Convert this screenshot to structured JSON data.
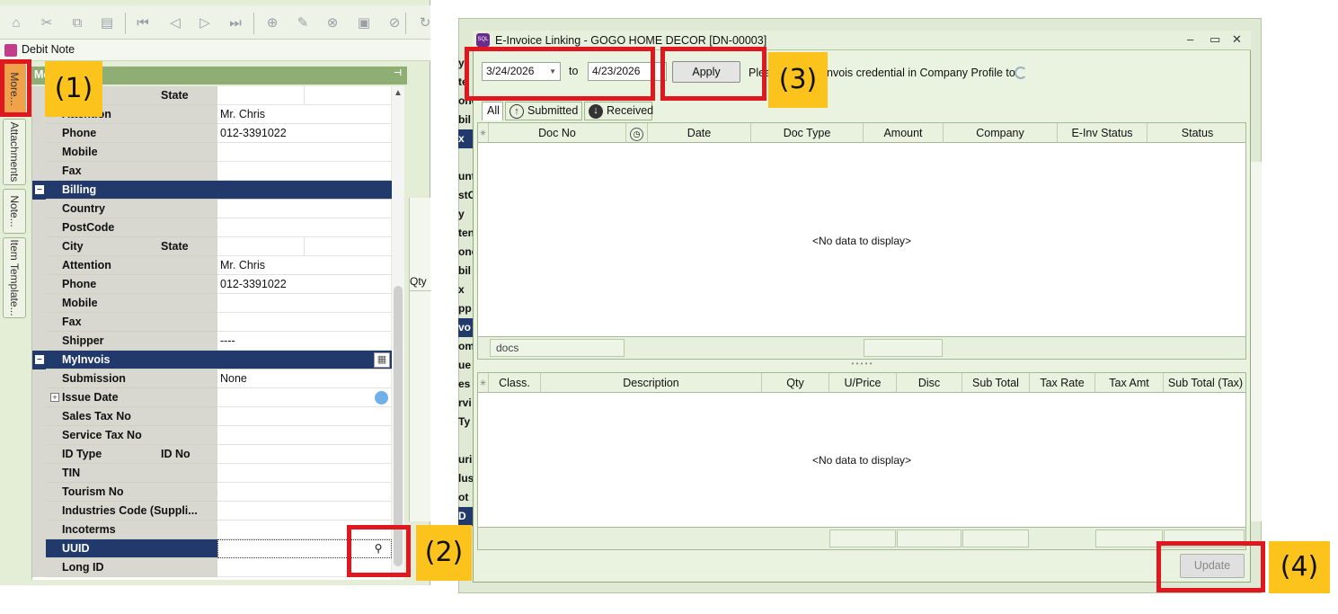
{
  "left_window": {
    "toolbar_icons": [
      "home-icon",
      "cut-icon",
      "copy-icon",
      "paste-icon",
      "first-record-icon",
      "prev-record-icon",
      "next-record-icon",
      "last-record-icon",
      "new-doc-icon",
      "edit-doc-icon",
      "delete-doc-icon",
      "save-icon",
      "cancel-icon",
      "refresh-icon"
    ],
    "title": "Debit Note",
    "vertical_tabs": [
      "More...",
      "Attachments",
      "Note...",
      "Item Template..."
    ],
    "grid_header": "Mo",
    "rows": [
      {
        "type": "field",
        "label": "",
        "label2": "State",
        "value": "",
        "split": true
      },
      {
        "type": "field",
        "label": "Attention",
        "value": "Mr. Chris"
      },
      {
        "type": "field",
        "label": "Phone",
        "value": "012-3391022"
      },
      {
        "type": "field",
        "label": "Mobile",
        "value": ""
      },
      {
        "type": "field",
        "label": "Fax",
        "value": ""
      },
      {
        "type": "category",
        "label": "Billing"
      },
      {
        "type": "field",
        "label": "Country",
        "value": ""
      },
      {
        "type": "field",
        "label": "PostCode",
        "value": ""
      },
      {
        "type": "field",
        "label": "City",
        "label2": "State",
        "value": "",
        "split": true
      },
      {
        "type": "field",
        "label": "Attention",
        "value": "Mr. Chris"
      },
      {
        "type": "field",
        "label": "Phone",
        "value": "012-3391022"
      },
      {
        "type": "field",
        "label": "Mobile",
        "value": ""
      },
      {
        "type": "field",
        "label": "Fax",
        "value": ""
      },
      {
        "type": "field",
        "label": "Shipper",
        "value": "----"
      },
      {
        "type": "category",
        "label": "MyInvois"
      },
      {
        "type": "field",
        "label": "Submission",
        "value": "None",
        "indent": true
      },
      {
        "type": "field",
        "label": "Issue Date",
        "value": "",
        "indent": true,
        "expand": true,
        "globe": true
      },
      {
        "type": "field",
        "label": "Sales Tax No",
        "value": "",
        "indent": true
      },
      {
        "type": "field",
        "label": "Service Tax No",
        "value": "",
        "indent": true
      },
      {
        "type": "field",
        "label": "ID Type",
        "label2": "ID No",
        "value": "",
        "indent": true
      },
      {
        "type": "field",
        "label": "TIN",
        "value": "",
        "indent": true
      },
      {
        "type": "field",
        "label": "Tourism No",
        "value": "",
        "indent": true
      },
      {
        "type": "field",
        "label": "Industries Code (Suppli...",
        "value": "",
        "indent": true
      },
      {
        "type": "field",
        "label": "Incoterms",
        "value": "",
        "indent": true
      },
      {
        "type": "field",
        "label": "UUID",
        "value": "",
        "indent": true,
        "selected": true,
        "search": true
      },
      {
        "type": "field",
        "label": "Long ID",
        "value": "",
        "indent": true
      }
    ],
    "peek_label": "Qty"
  },
  "dialog": {
    "title": "E-Invoice Linking - GOGO HOME DECOR [DN-00003]",
    "window_buttons": [
      "–",
      "▭",
      "✕"
    ],
    "date_from": "3/24/2026",
    "date_to": "4/23/2026",
    "to_label": "to",
    "apply_label": "Apply",
    "notice_start": "Pleas",
    "notice_end": "nvois credential in Company Profile to",
    "tabs": [
      "All",
      "Submitted",
      "Received"
    ],
    "doc_columns": [
      "Doc No",
      "Date",
      "Doc Type",
      "Amount",
      "Company",
      "E-Inv Status",
      "Status"
    ],
    "detail_columns": [
      "Class.",
      "Description",
      "Qty",
      "U/Price",
      "Disc",
      "Sub Total",
      "Tax Rate",
      "Tax Amt",
      "Sub Total (Tax)"
    ],
    "no_data": "<No data to display>",
    "footer_docs": "docs",
    "update_label": "Update",
    "left_peek": [
      "y",
      "te",
      "one",
      "bil",
      "x",
      "",
      "unt",
      "stC",
      "y",
      "ten",
      "one",
      "bil",
      "x",
      "pp",
      "vo",
      "om",
      "ue",
      "es",
      "rvi",
      "Ty",
      "",
      "uris",
      "lus",
      "ot",
      "D"
    ]
  },
  "annotations": [
    "(1)",
    "(2)",
    "(3)",
    "(4)"
  ],
  "colors": {
    "highlight_red": "#e0171f",
    "callout_yellow": "#fbc31b",
    "category_navy": "#213a6b",
    "header_green": "#8fae74"
  }
}
